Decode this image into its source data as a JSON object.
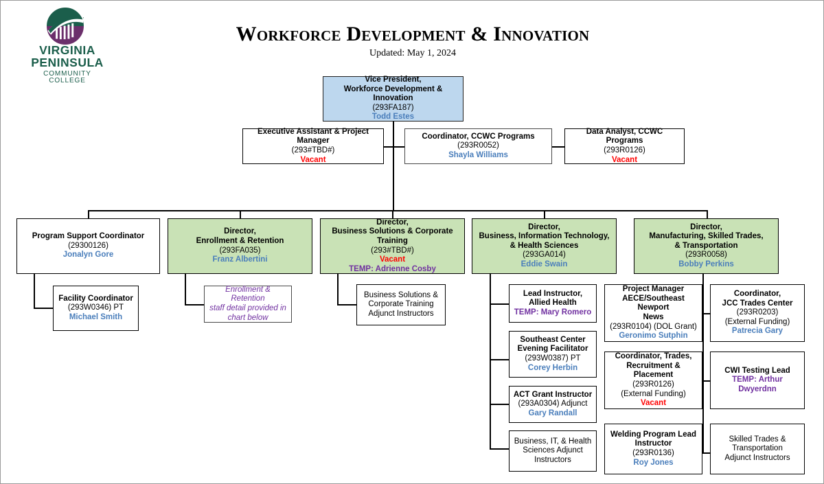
{
  "header": {
    "logo": {
      "line1": "VIRGINIA",
      "line2": "PENINSULA",
      "line3": "COMMUNITY COLLEGE",
      "green": "#1b5e4b",
      "purple": "#6b2f6b"
    },
    "title": "Workforce Development & Innovation",
    "updated": "Updated: May 1, 2024"
  },
  "colors": {
    "vp_fill": "#bdd7ee",
    "director_fill": "#c9e2b6",
    "name_text": "#4a7ebb",
    "vacant_text": "#ff0000",
    "temp_text": "#7030a0",
    "note_text": "#7030a0"
  },
  "nodes": {
    "vp": {
      "title_l1": "Vice President,",
      "title_l2": "Workforce Development & Innovation",
      "code": "(293FA187)",
      "name": "Todd Estes"
    },
    "exec_assistant": {
      "title_l1": "Executive Assistant & Project Manager",
      "code": "(293#TBD#)",
      "status": "Vacant"
    },
    "coordinator_ccwc": {
      "title_l1": "Coordinator, CCWC Programs",
      "code": "(293R0052)",
      "name": "Shayla Williams"
    },
    "data_analyst": {
      "title_l1": "Data Analyst, CCWC Programs",
      "code": "(293R0126)",
      "status": "Vacant"
    },
    "program_support": {
      "title_l1": "Program Support Coordinator",
      "code": "(29300126)",
      "name": "Jonalyn Gore"
    },
    "facility_coordinator": {
      "title_l1": "Facility Coordinator",
      "code": "(293W0346) PT",
      "name": "Michael Smith"
    },
    "dir_enrollment": {
      "title_l1": "Director,",
      "title_l2": "Enrollment & Retention",
      "code": "(293FA035)",
      "name": "Franz Albertini"
    },
    "enrollment_note": {
      "note_l1": "Enrollment & Retention",
      "note_l2": "staff detail provided in",
      "note_l3": "chart below"
    },
    "dir_business_solutions": {
      "title_l1": "Director,",
      "title_l2": "Business Solutions & Corporate Training",
      "code": "(293#TBD#)",
      "status": "Vacant",
      "temp": "TEMP: Adrienne Cosby"
    },
    "bs_adjunct": {
      "line1": "Business Solutions &",
      "line2": "Corporate Training",
      "line3": "Adjunct Instructors"
    },
    "dir_bit_health": {
      "title_l1": "Director,",
      "title_l2": "Business, Information Technology,",
      "title_l3": "& Health Sciences",
      "code": "(293GA014)",
      "name": "Eddie Swain"
    },
    "lead_instructor_allied": {
      "title_l1": "Lead Instructor,",
      "title_l2": "Allied Health",
      "temp": "TEMP: Mary Romero"
    },
    "southeast_evening": {
      "title_l1": "Southeast Center",
      "title_l2": "Evening Facilitator",
      "code": "(293W0387) PT",
      "name": "Corey Herbin"
    },
    "act_grant_instructor": {
      "title_l1": "ACT Grant Instructor",
      "code": "(293A0304) Adjunct",
      "name": "Gary Randall"
    },
    "bit_adjunct": {
      "line1": "Business, IT, & Health",
      "line2": "Sciences Adjunct",
      "line3": "Instructors"
    },
    "dir_manufacturing": {
      "title_l1": "Director,",
      "title_l2": "Manufacturing, Skilled Trades,",
      "title_l3": "& Transportation",
      "code": "(293R0058)",
      "name": "Bobby Perkins"
    },
    "project_manager_aece": {
      "title_l1": "Project Manager",
      "title_l2": "AECE/Southeast Newport",
      "title_l3": "News",
      "code": "(293R0104) (DOL Grant)",
      "name": "Geronimo Sutphin"
    },
    "coordinator_trades": {
      "title_l1": "Coordinator, Trades,",
      "title_l2": "Recruitment & Placement",
      "code": "(293R0126)",
      "funding": "(External Funding)",
      "status": "Vacant"
    },
    "welding_lead": {
      "title_l1": "Welding Program Lead",
      "title_l2": "Instructor",
      "code": "(293R0136)",
      "name": "Roy Jones"
    },
    "coordinator_jcc": {
      "title_l1": "Coordinator,",
      "title_l2": "JCC Trades Center",
      "code": "(293R0203)",
      "funding": "(External Funding)",
      "name": "Patrecia Gary"
    },
    "cwi_testing_lead": {
      "title_l1": "CWI Testing Lead",
      "temp": "TEMP: Arthur Dwyerdnn"
    },
    "skilled_trades_adjunct": {
      "line1": "Skilled Trades &",
      "line2": "Transportation",
      "line3": "Adjunct Instructors"
    }
  }
}
